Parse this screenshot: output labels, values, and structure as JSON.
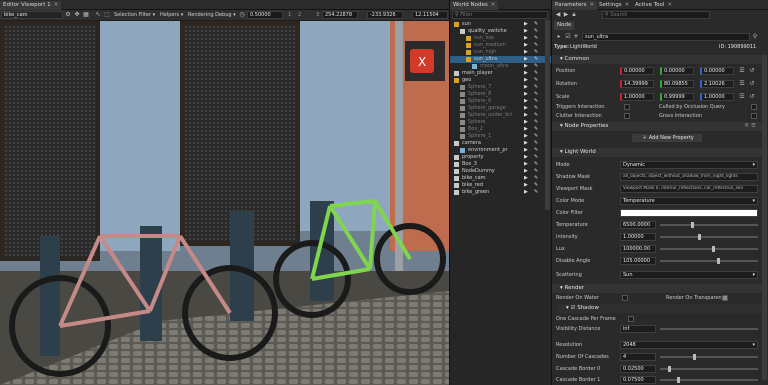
{
  "viewport": {
    "tab_title": "Editor Viewport 1",
    "camera": "bike_cam",
    "selection_filter": "Selection Filter",
    "helpers": "Helpers",
    "rendering_debug": "Rendering Debug",
    "speed": "0.50000",
    "pos_x": "254.22878",
    "pos_y": "-233.9326",
    "pos_z": "12.11504",
    "axis_1": "1",
    "axis_2": "2",
    "axis_3": "3"
  },
  "world_nodes": {
    "tab_title": "World Nodes",
    "filter_placeholder": "Filter",
    "nodes": [
      {
        "label": "sun",
        "indent": 0,
        "dim": false,
        "sel": false,
        "color": "#d6a22a"
      },
      {
        "label": "quality_switche",
        "indent": 1,
        "dim": false,
        "sel": false,
        "color": "#c9c9c9"
      },
      {
        "label": "sun_low",
        "indent": 2,
        "dim": true,
        "sel": false,
        "color": "#d6a22a"
      },
      {
        "label": "sun_medium",
        "indent": 2,
        "dim": true,
        "sel": false,
        "color": "#d6a22a"
      },
      {
        "label": "sun_high",
        "indent": 2,
        "dim": true,
        "sel": false,
        "color": "#d6a22a"
      },
      {
        "label": "sun_ultra",
        "indent": 2,
        "dim": false,
        "sel": true,
        "color": "#d6a22a"
      },
      {
        "label": "moon_ultra",
        "indent": 3,
        "dim": true,
        "sel": false,
        "color": "#7ab0d8"
      },
      {
        "label": "main_player",
        "indent": 0,
        "dim": false,
        "sel": false,
        "color": "#c9c9c9"
      },
      {
        "label": "geo",
        "indent": 0,
        "dim": false,
        "sel": false,
        "color": "#d6a22a"
      },
      {
        "label": "Sphere_7",
        "indent": 1,
        "dim": true,
        "sel": false,
        "color": "#8a8a8a"
      },
      {
        "label": "Sphere_8",
        "indent": 1,
        "dim": true,
        "sel": false,
        "color": "#8a8a8a"
      },
      {
        "label": "Sphere_6",
        "indent": 1,
        "dim": true,
        "sel": false,
        "color": "#8a8a8a"
      },
      {
        "label": "Sphere_garage",
        "indent": 1,
        "dim": true,
        "sel": false,
        "color": "#8a8a8a"
      },
      {
        "label": "Sphere_under_bri",
        "indent": 1,
        "dim": true,
        "sel": false,
        "color": "#8a8a8a"
      },
      {
        "label": "Sphere",
        "indent": 1,
        "dim": true,
        "sel": false,
        "color": "#8a8a8a"
      },
      {
        "label": "Box_2",
        "indent": 1,
        "dim": true,
        "sel": false,
        "color": "#8a8a8a"
      },
      {
        "label": "Sphere_1",
        "indent": 1,
        "dim": true,
        "sel": false,
        "color": "#8a8a8a"
      },
      {
        "label": "camera",
        "indent": 0,
        "dim": false,
        "sel": false,
        "color": "#c9c9c9"
      },
      {
        "label": "environment_pr",
        "indent": 1,
        "dim": false,
        "sel": false,
        "color": "#7ab0d8"
      },
      {
        "label": "property",
        "indent": 0,
        "dim": false,
        "sel": false,
        "color": "#c9c9c9"
      },
      {
        "label": "Box_3",
        "indent": 0,
        "dim": false,
        "sel": false,
        "color": "#c9c9c9"
      },
      {
        "label": "NodeDummy",
        "indent": 0,
        "dim": false,
        "sel": false,
        "color": "#c9c9c9"
      },
      {
        "label": "bike_cam",
        "indent": 0,
        "dim": false,
        "sel": false,
        "color": "#c9c9c9"
      },
      {
        "label": "bike_red",
        "indent": 0,
        "dim": false,
        "sel": false,
        "color": "#c9c9c9"
      },
      {
        "label": "bike_green",
        "indent": 0,
        "dim": false,
        "sel": false,
        "color": "#c9c9c9"
      }
    ]
  },
  "params": {
    "tabs": [
      "Parameters",
      "Settings",
      "Active Tool"
    ],
    "search_placeholder": "Search",
    "node_tab": "Node",
    "node_name": "sun_ultra",
    "type_label": "Type:",
    "type_value": "LightWorld",
    "id_label": "ID: 190899011",
    "sections": {
      "common": "Common",
      "node_properties": "Node Properties",
      "light_world": "Light World",
      "render": "Render",
      "shadow": "Shadow"
    },
    "position": {
      "label": "Position",
      "x": "0.00000",
      "y": "0.00000",
      "z": "0.00000"
    },
    "rotation": {
      "label": "Rotation",
      "x": "14.39999",
      "y": "80.09855",
      "z": "2.10026"
    },
    "scale": {
      "label": "Scale",
      "x": "1.00000",
      "y": "0.99999",
      "z": "1.00000"
    },
    "triggers_interaction": "Triggers Interaction",
    "culled_by_occlusion": "Culled by Occlusion Query",
    "clutter_interaction": "Clutter Interaction",
    "grass_interaction": "Grass Interaction",
    "add_property": "Add New Property",
    "light": {
      "mode_label": "Mode",
      "mode": "Dynamic",
      "shadow_mask_label": "Shadow Mask",
      "shadow_mask": "all_objects, object_without_shadow_from_night_lights",
      "viewport_mask_label": "Viewport Mask",
      "viewport_mask": "Viewport Mask 0, interior_reflections, car_reflection_sen",
      "color_mode_label": "Color Mode",
      "color_mode": "Temperature",
      "color_filter_label": "Color Filter",
      "temperature_label": "Temperature",
      "temperature": "6500.0000",
      "intensity_label": "Intensity",
      "intensity": "1.00000",
      "lux_label": "Lux",
      "lux": "100000.00",
      "disable_angle_label": "Disable Angle",
      "disable_angle": "105.00000",
      "scattering_label": "Scattering",
      "scattering": "Sun"
    },
    "render": {
      "render_on_water": "Render On Water",
      "render_on_transparent": "Render On Transparent",
      "one_cascade": "One Cascade Per Frame",
      "visibility_distance_label": "Visibility Distance",
      "visibility_distance": "inf",
      "resolution_label": "Resolution",
      "resolution": "2048",
      "num_cascades_label": "Number Of Cascades",
      "num_cascades": "4",
      "cascade_0_label": "Cascade Border 0",
      "cascade_0": "0.02500",
      "cascade_1_label": "Cascade Border 1",
      "cascade_1": "0.07500"
    },
    "sliders": {
      "temperature": 0.33,
      "intensity": 0.4,
      "lux": 0.55,
      "disable_angle": 0.6,
      "num_cascades": 0.35,
      "cascade_0": 0.08,
      "cascade_1": 0.18
    },
    "color_filter_value": "#ffffff"
  }
}
